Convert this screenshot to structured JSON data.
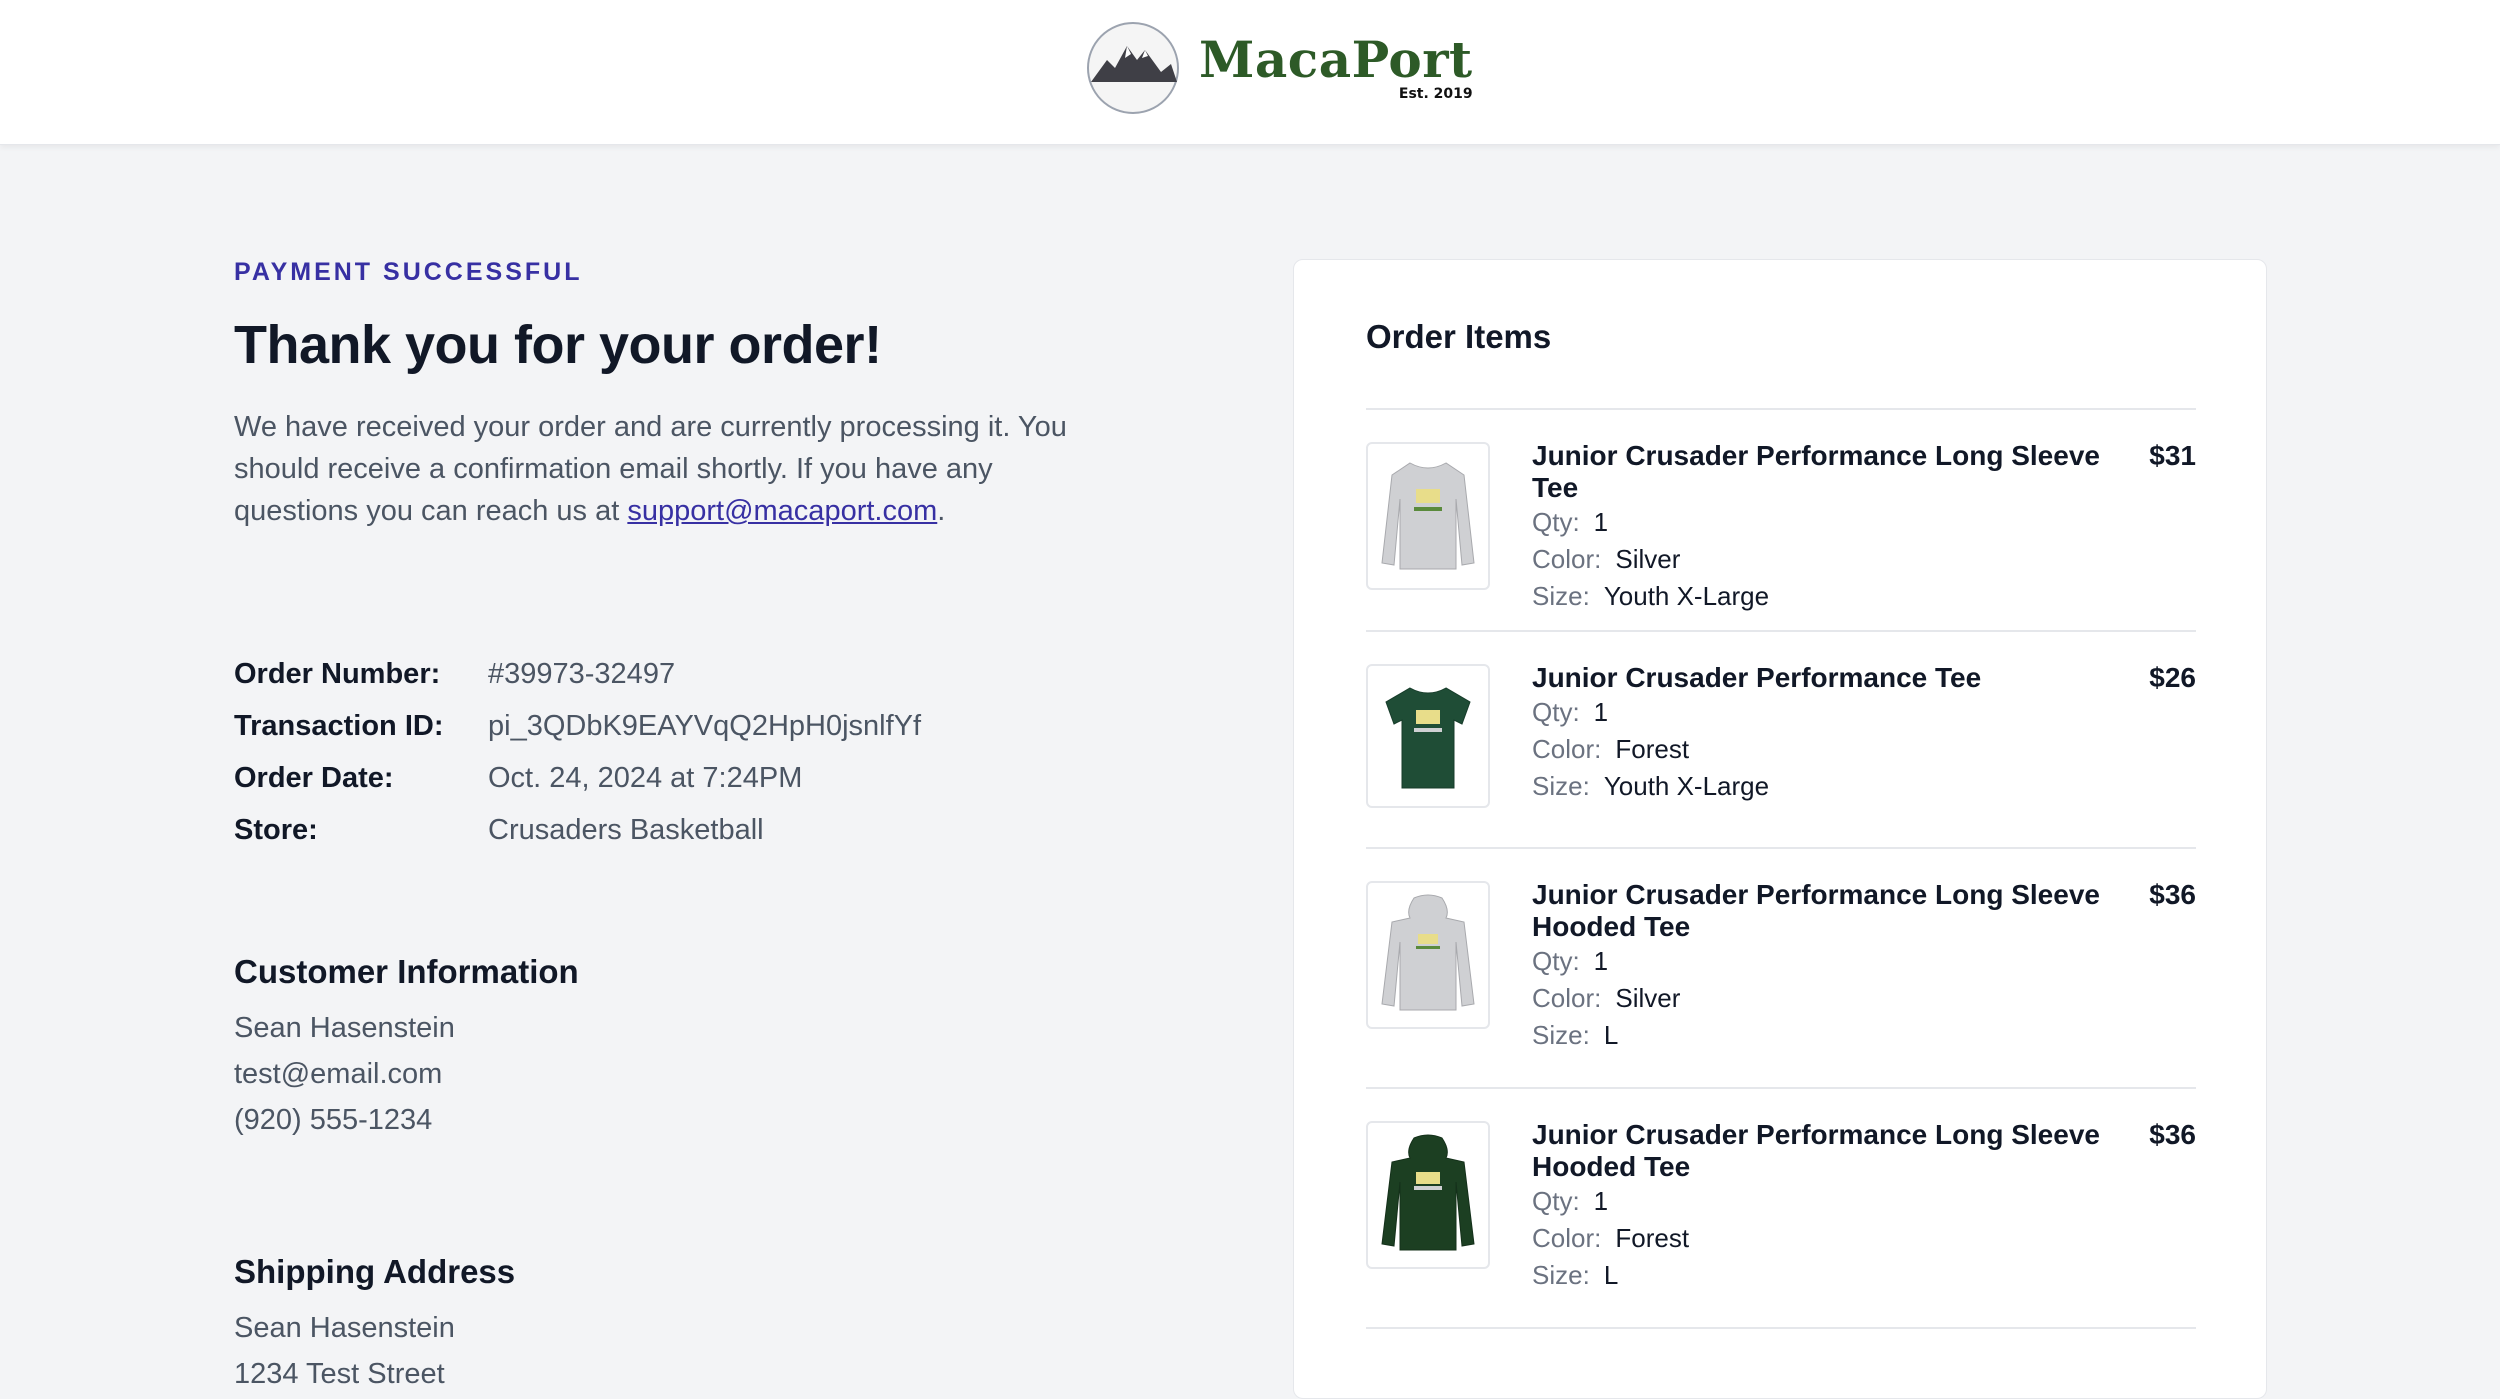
{
  "brand": {
    "name": "MacaPort",
    "est": "Est. 2019",
    "color": "#2d5a27"
  },
  "status": {
    "eyebrow": "PAYMENT SUCCESSFUL",
    "title": "Thank you for your order!",
    "intro_prefix": "We have received your order and are currently processing it. You should receive a confirmation email shortly. If you have any questions you can reach us at ",
    "support_email": "support@macaport.com",
    "intro_suffix": "."
  },
  "details": [
    {
      "label": "Order Number:",
      "value": "#39973-32497"
    },
    {
      "label": "Transaction ID:",
      "value": "pi_3QDbK9EAYVqQ2HpH0jsnlfYf"
    },
    {
      "label": "Order Date:",
      "value": "Oct. 24, 2024 at 7:24PM"
    },
    {
      "label": "Store:",
      "value": "Crusaders Basketball"
    }
  ],
  "customer": {
    "title": "Customer Information",
    "name": "Sean Hasenstein",
    "email": "test@email.com",
    "phone": "(920) 555-1234"
  },
  "shipping": {
    "title": "Shipping Address",
    "name": "Sean Hasenstein",
    "street": "1234 Test Street"
  },
  "order_items": {
    "title": "Order Items",
    "labels": {
      "qty": "Qty:",
      "color": "Color:",
      "size": "Size:"
    },
    "items": [
      {
        "name": "Junior Crusader Performance Long Sleeve Tee",
        "qty": "1",
        "color": "Silver",
        "size": "Youth X-Large",
        "price": "$31",
        "icon": "silver-long-sleeve-tee-icon"
      },
      {
        "name": "Junior Crusader Performance Tee",
        "qty": "1",
        "color": "Forest",
        "size": "Youth X-Large",
        "price": "$26",
        "icon": "forest-tee-icon"
      },
      {
        "name": "Junior Crusader Performance Long Sleeve Hooded Tee",
        "qty": "1",
        "color": "Silver",
        "size": "L",
        "price": "$36",
        "icon": "silver-hooded-tee-icon"
      },
      {
        "name": "Junior Crusader Performance Long Sleeve Hooded Tee",
        "qty": "1",
        "color": "Forest",
        "size": "L",
        "price": "$36",
        "icon": "forest-hooded-tee-icon"
      }
    ]
  }
}
